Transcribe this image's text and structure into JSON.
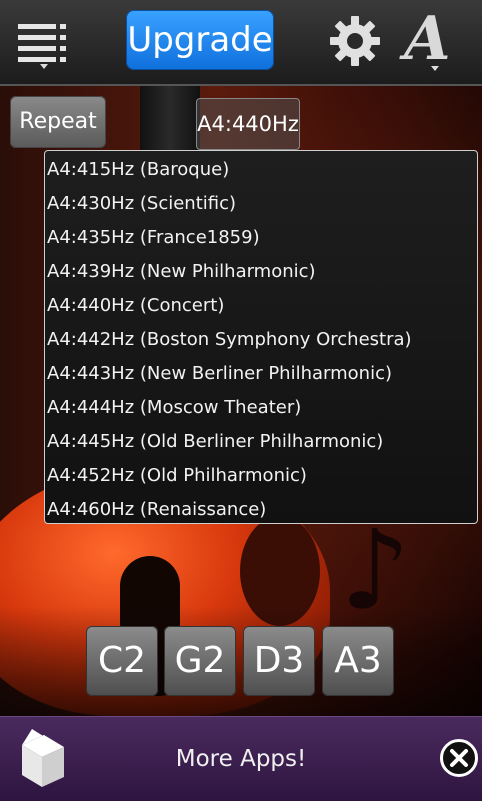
{
  "toolbar": {
    "menu_icon": "list-menu-icon",
    "upgrade_label": "Upgrade",
    "settings_icon": "gear-icon",
    "font_letter": "A"
  },
  "controls": {
    "repeat_label": "Repeat",
    "frequency_value": "A4:440Hz"
  },
  "dropdown": {
    "options": [
      "A4:415Hz (Baroque)",
      "A4:430Hz (Scientific)",
      "A4:435Hz (France1859)",
      "A4:439Hz (New Philharmonic)",
      "A4:440Hz (Concert)",
      "A4:442Hz (Boston Symphony Orchestra)",
      "A4:443Hz (New Berliner Philharmonic)",
      "A4:444Hz (Moscow Theater)",
      "A4:445Hz (Old Berliner Philharmonic)",
      "A4:452Hz (Old Philharmonic)",
      "A4:460Hz (Renaissance)"
    ]
  },
  "notes": [
    "C2",
    "G2",
    "D3",
    "A3"
  ],
  "ad": {
    "text": "More Apps!",
    "logo_icon": "box-logo-icon",
    "close_icon": "close-icon"
  },
  "colors": {
    "upgrade_blue": "#1a86f0",
    "ad_purple": "#3d1f50",
    "violin_orange": "#d8380d"
  }
}
